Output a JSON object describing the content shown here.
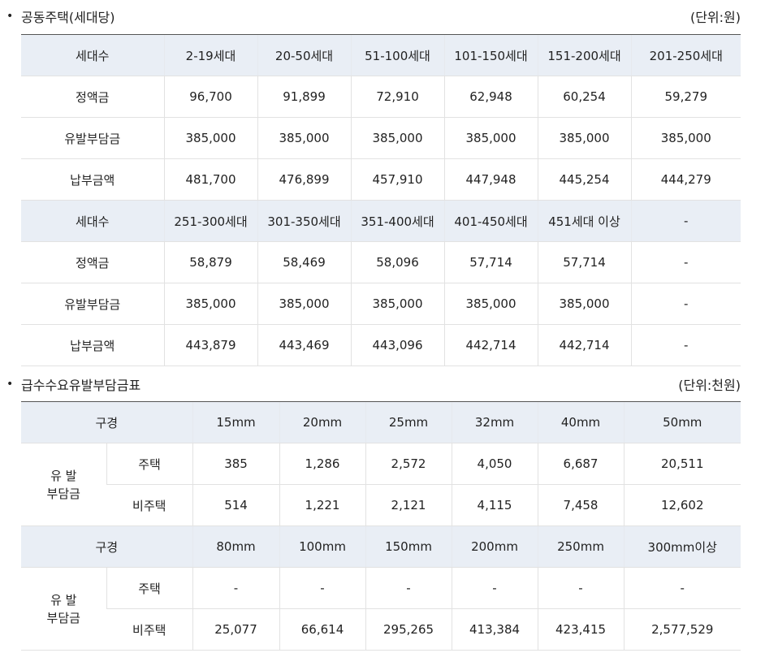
{
  "section1": {
    "title": "공동주택(세대당)",
    "unit": "(단위:원)",
    "blocks": [
      {
        "header": [
          "세대수",
          "2-19세대",
          "20-50세대",
          "51-100세대",
          "101-150세대",
          "151-200세대",
          "201-250세대"
        ],
        "rows": [
          [
            "정액금",
            "96,700",
            "91,899",
            "72,910",
            "62,948",
            "60,254",
            "59,279"
          ],
          [
            "유발부담금",
            "385,000",
            "385,000",
            "385,000",
            "385,000",
            "385,000",
            "385,000"
          ],
          [
            "납부금액",
            "481,700",
            "476,899",
            "457,910",
            "447,948",
            "445,254",
            "444,279"
          ]
        ]
      },
      {
        "header": [
          "세대수",
          "251-300세대",
          "301-350세대",
          "351-400세대",
          "401-450세대",
          "451세대 이상",
          "-"
        ],
        "rows": [
          [
            "정액금",
            "58,879",
            "58,469",
            "58,096",
            "57,714",
            "57,714",
            "-"
          ],
          [
            "유발부담금",
            "385,000",
            "385,000",
            "385,000",
            "385,000",
            "385,000",
            "-"
          ],
          [
            "납부금액",
            "443,879",
            "443,469",
            "443,096",
            "442,714",
            "442,714",
            "-"
          ]
        ]
      }
    ]
  },
  "section2": {
    "title": "급수수요유발부담금표",
    "unit": "(단위:천원)",
    "blocks": [
      {
        "header_label": "구경",
        "sizes": [
          "15mm",
          "20mm",
          "25mm",
          "32mm",
          "40mm",
          "50mm"
        ],
        "group_label_line1": "유 발",
        "group_label_line2": "부담금",
        "rows": [
          {
            "label": "주택",
            "values": [
              "385",
              "1,286",
              "2,572",
              "4,050",
              "6,687",
              "20,511"
            ]
          },
          {
            "label": "비주택",
            "values": [
              "514",
              "1,221",
              "2,121",
              "4,115",
              "7,458",
              "12,602"
            ]
          }
        ]
      },
      {
        "header_label": "구경",
        "sizes": [
          "80mm",
          "100mm",
          "150mm",
          "200mm",
          "250mm",
          "300mm이상"
        ],
        "group_label_line1": "유 발",
        "group_label_line2": "부담금",
        "rows": [
          {
            "label": "주택",
            "values": [
              "-",
              "-",
              "-",
              "-",
              "-",
              "-"
            ]
          },
          {
            "label": "비주택",
            "values": [
              "25,077",
              "66,614",
              "295,265",
              "413,384",
              "423,415",
              "2,577,529"
            ]
          }
        ]
      }
    ]
  }
}
